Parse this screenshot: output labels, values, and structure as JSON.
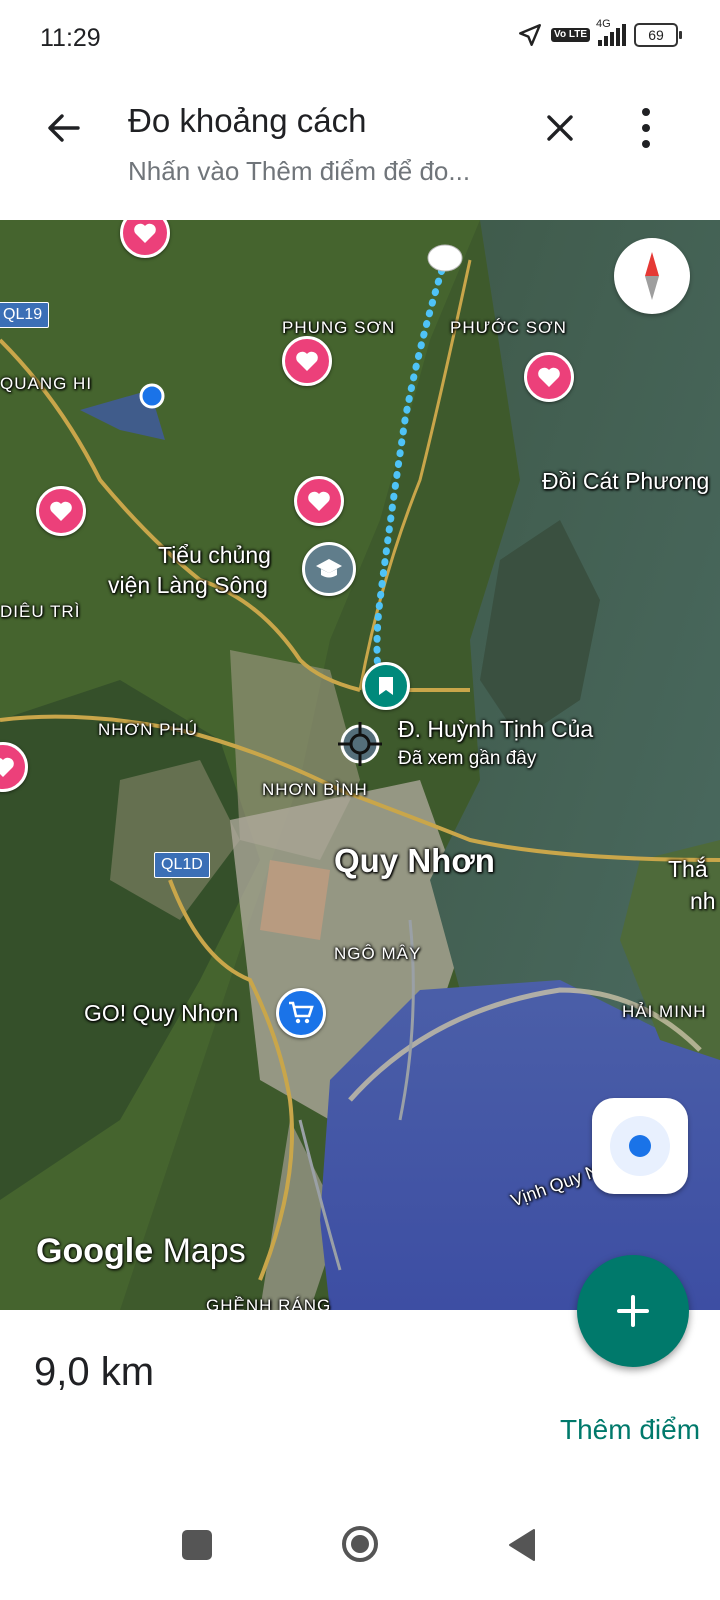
{
  "status": {
    "time": "11:29",
    "network": "4G",
    "volte": "Vo LTE",
    "battery": "69"
  },
  "header": {
    "title": "Đo khoảng cách",
    "subtitle": "Nhấn vào Thêm điểm để đo..."
  },
  "map": {
    "labels": {
      "phung_son": "PHUNG SƠN",
      "phuoc_son": "PHƯỚC SƠN",
      "quang_hi": "QUANG HI",
      "doi_cat": "Đồi Cát Phương",
      "tieu_chung_vien_1": "Tiểu chủng",
      "tieu_chung_vien_2": "viện Làng Sông",
      "dieu_tri": "DIÊU TRÌ",
      "nhon_phu": "NHƠN PHÚ",
      "huynh_tinh_cua": "Đ. Huỳnh Tịnh Của",
      "recently_viewed": "Đã xem gần đây",
      "nhon_binh": "NHƠN BÌNH",
      "quy_nhon": "Quy Nhơn",
      "ngo_may": "NGÔ MÂY",
      "go_quy_nhon": "GO! Quy Nhơn",
      "thang_1": "Thắ",
      "thang_2": "nh",
      "hai_minh": "HẢI MINH",
      "vinh_quy_nhon": "Vịnh Quy Nhơn",
      "ghenh_rang": "GHỀNH RÁNG"
    },
    "shields": {
      "ql19": "QL19",
      "ql1d": "QL1D"
    },
    "logo": {
      "google": "Google",
      "maps": "Maps"
    },
    "route_color": "#4fc3f7",
    "pin_color": "#ec407a",
    "icons": [
      "heart-icon",
      "graduation-cap-icon",
      "bookmark-icon",
      "crosshair-icon",
      "shopping-cart-icon",
      "compass-icon",
      "my-location-icon"
    ]
  },
  "bottom": {
    "distance": "9,0 km",
    "add_point_label": "Thêm điểm",
    "fab_icon": "plus-icon"
  },
  "accent": "#00796b"
}
